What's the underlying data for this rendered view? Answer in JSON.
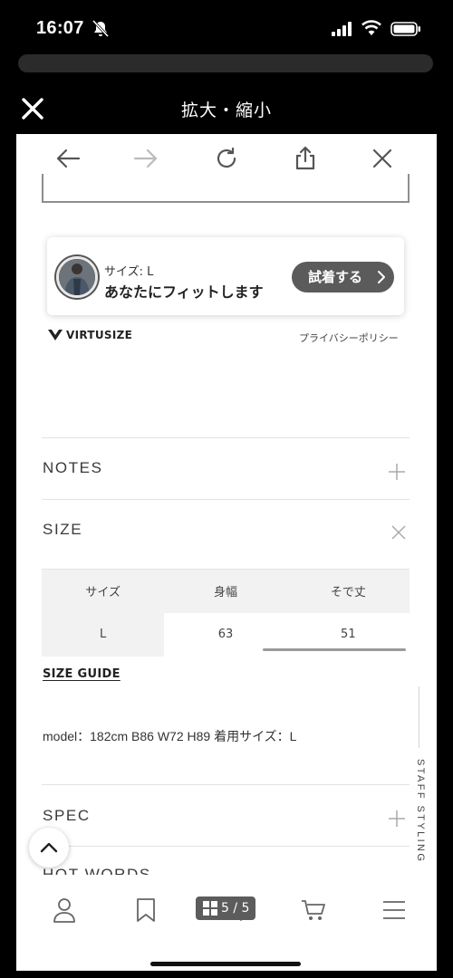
{
  "status_bar": {
    "time": "16:07"
  },
  "viewer": {
    "title": "拡大・縮小"
  },
  "virtusize": {
    "size_label": "サイズ: L",
    "fit_text": "あなたにフィットします",
    "try_button": "試着する",
    "brand": "VIRTUSIZE",
    "privacy": "プライバシーポリシー"
  },
  "sections": {
    "notes": "NOTES",
    "size": "SIZE",
    "spec": "SPEC",
    "hot_words": "HOT WORDS"
  },
  "size_table": {
    "headers": [
      "サイズ",
      "身幅",
      "そで丈"
    ],
    "rows": [
      [
        "L",
        "63",
        "51"
      ]
    ]
  },
  "size_guide": "SIZE GUIDE",
  "model_info": "model：182cm B86 W72 H89 着用サイズ：L",
  "staff_styling": "STAFF STYLING",
  "pager": {
    "label": "5 / 5"
  }
}
